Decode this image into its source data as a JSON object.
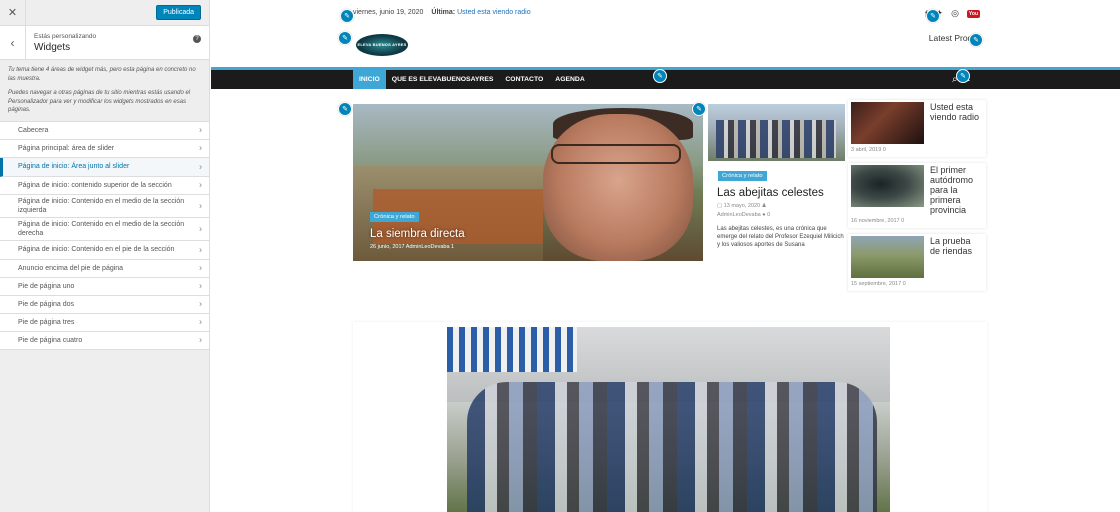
{
  "sidebar": {
    "close_icon": "close-icon",
    "publish_label": "Publicada",
    "heading_small": "Estás personalizando",
    "heading_big": "Widgets",
    "desc1": "Tu tema tiene 4 áreas de widget más, pero esta página en concreto no las muestra.",
    "desc2": "Puedes navegar a otras páginas de tu sitio mientras estás usando el Personalizador para ver y modificar los widgets mostrados en esas páginas.",
    "items": [
      {
        "label": "Cabecera"
      },
      {
        "label": "Página principal: área de slider"
      },
      {
        "label": "Página de inicio: Área junto al slider"
      },
      {
        "label": "Página de inicio: contenido superior de la sección"
      },
      {
        "label": "Página de inicio: Contenido en el medio de la sección izquierda"
      },
      {
        "label": "Página de inicio: Contenido en el medio de la sección derecha"
      },
      {
        "label": "Página de inicio: Contenido en el pie de la sección"
      },
      {
        "label": "Anuncio encima del pie de página"
      },
      {
        "label": "Pie de página uno"
      },
      {
        "label": "Pie de página dos"
      },
      {
        "label": "Pie de página tres"
      },
      {
        "label": "Pie de página cuatro"
      }
    ],
    "active_index": 2
  },
  "preview": {
    "date": "viernes, junio 19, 2020",
    "ultima_label": "Última:",
    "ultima_link": "Usted esta viendo radio",
    "logo_text": "ELEVA BUENOS AYRES",
    "latest_products": "Latest Produ",
    "nav": [
      "INICIO",
      "QUE ES ELEVABUENOSAYRES",
      "CONTACTO",
      "AGENDA"
    ],
    "featured": {
      "category": "Crónica y relato",
      "title": "La siembra directa",
      "meta": "26 junio, 2017   AdminLeoDevaba   1"
    },
    "post2": {
      "category": "Crónica y relato",
      "title": "Las abejitas celestes",
      "meta_date": "13 mayo, 2020",
      "meta_author": "AdminLeoDevaba",
      "meta_comments": "0",
      "excerpt": "Las abejitas celestes, es una crónica que emerge del relato del Profesor Ezequiel Milicich y los valiosos aportes de Susana"
    },
    "right_posts": [
      {
        "title": "Usted esta viendo radio",
        "meta": "3 abril, 2019   0"
      },
      {
        "title": "El primer autódromo para la primera provincia",
        "meta": "16 noviembre, 2017   0"
      },
      {
        "title": "La prueba de riendas",
        "meta": "15 septiembre, 2017   0"
      }
    ]
  },
  "colors": {
    "accent": "#3fa7d6",
    "customizer_blue": "#0085ba",
    "nav_bg": "#1b1b1b"
  }
}
